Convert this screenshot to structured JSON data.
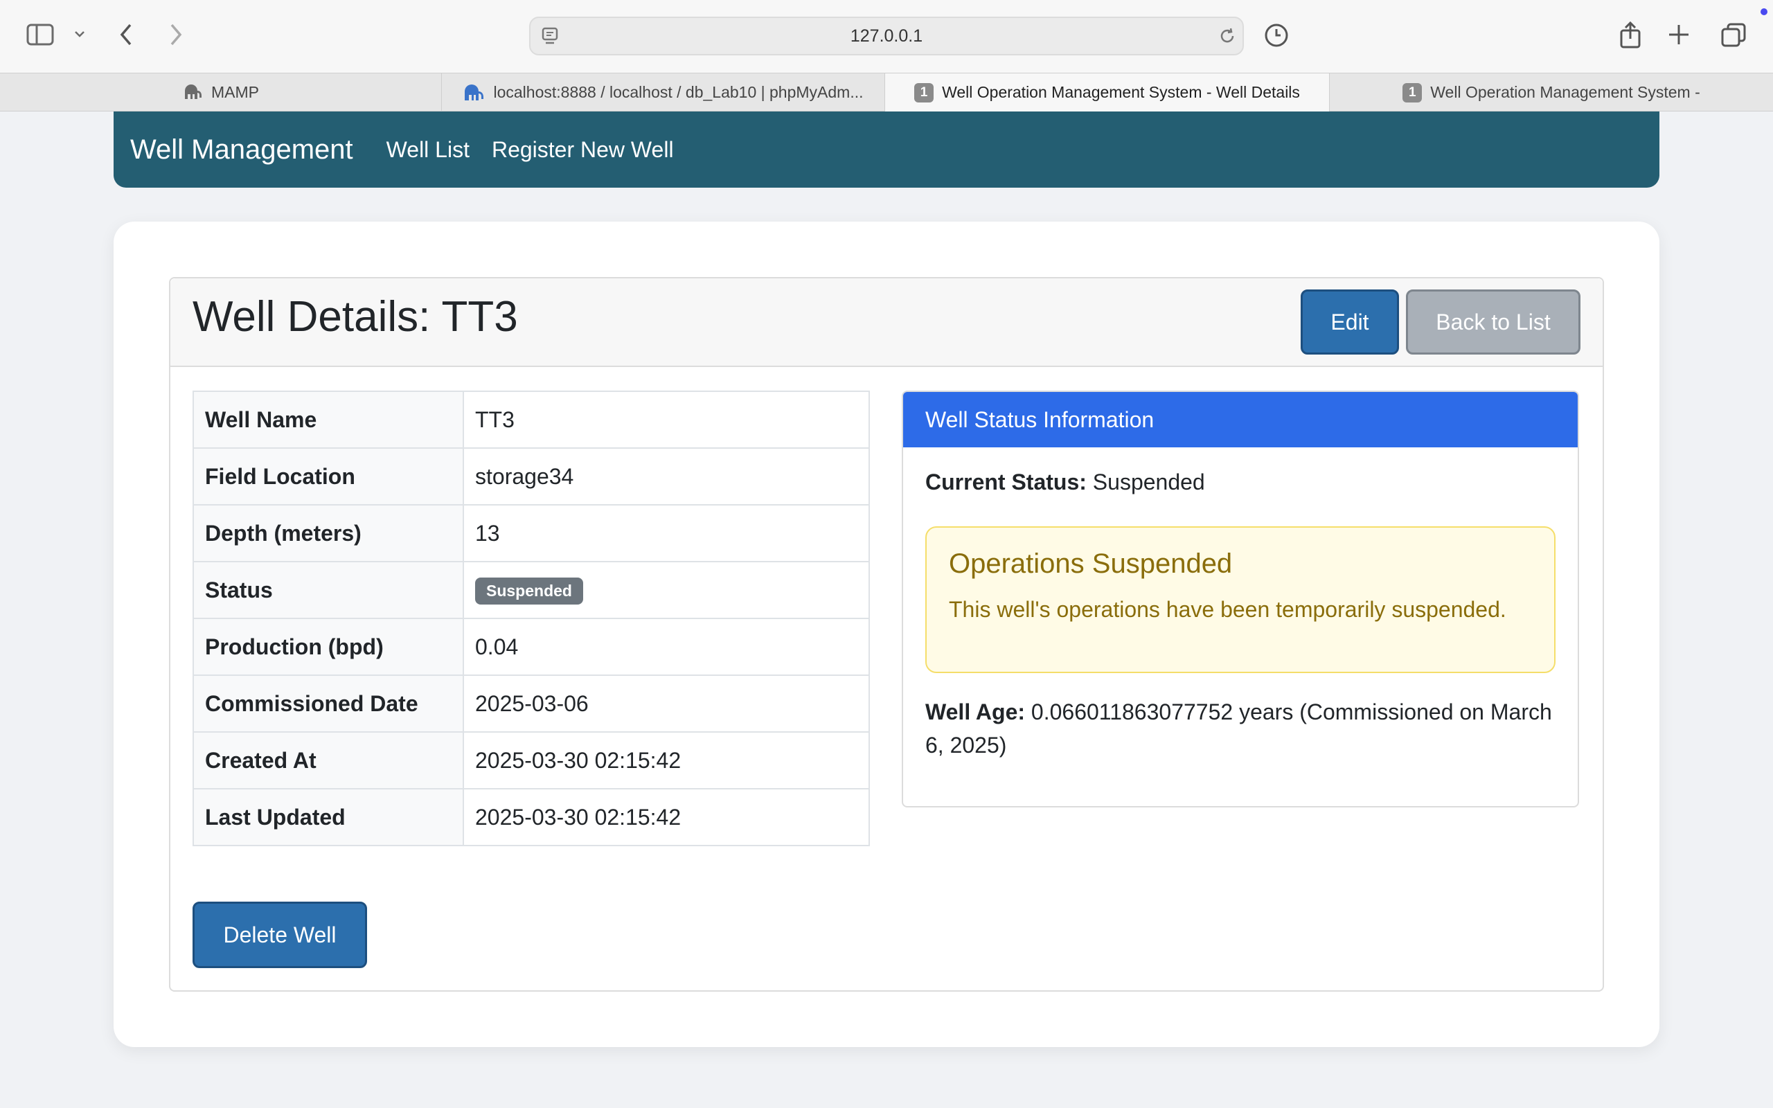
{
  "browser": {
    "address": "127.0.0.1",
    "tabs": [
      {
        "label": "MAMP",
        "icon": "elephant-icon"
      },
      {
        "label": "localhost:8888 / localhost / db_Lab10 | phpMyAdm...",
        "icon": "phpmyadmin-icon"
      },
      {
        "label": "Well Operation Management System - Well Details",
        "badge": "1",
        "active": true
      },
      {
        "label": "Well Operation Management System -",
        "badge": "1"
      }
    ]
  },
  "nav": {
    "brand": "Well Management",
    "links": [
      "Well List",
      "Register New Well"
    ]
  },
  "header": {
    "title": "Well Details: TT3",
    "edit_label": "Edit",
    "back_label": "Back to List"
  },
  "details": [
    {
      "key": "Well Name",
      "value": "TT3"
    },
    {
      "key": "Field Location",
      "value": "storage34"
    },
    {
      "key": "Depth (meters)",
      "value": "13"
    },
    {
      "key": "Status",
      "value": "Suspended"
    },
    {
      "key": "Production (bpd)",
      "value": "0.04"
    },
    {
      "key": "Commissioned Date",
      "value": "2025-03-06"
    },
    {
      "key": "Created At",
      "value": "2025-03-30 02:15:42"
    },
    {
      "key": "Last Updated",
      "value": "2025-03-30 02:15:42"
    }
  ],
  "status_panel": {
    "header": "Well Status Information",
    "current_label": "Current Status:",
    "current_value": "Suspended",
    "alert_title": "Operations Suspended",
    "alert_body": "This well's operations have been temporarily suspended.",
    "age_label": "Well Age:",
    "age_value": "0.066011863077752 years (Commissioned on March 6, 2025)"
  },
  "actions": {
    "delete_label": "Delete Well"
  },
  "colors": {
    "navbar": "#245e72",
    "primary": "#2c6fad",
    "status_header": "#2d6be8",
    "alert_bg": "#fffbe6",
    "alert_text": "#8a6d0b",
    "badge_grey": "#6c757d"
  }
}
